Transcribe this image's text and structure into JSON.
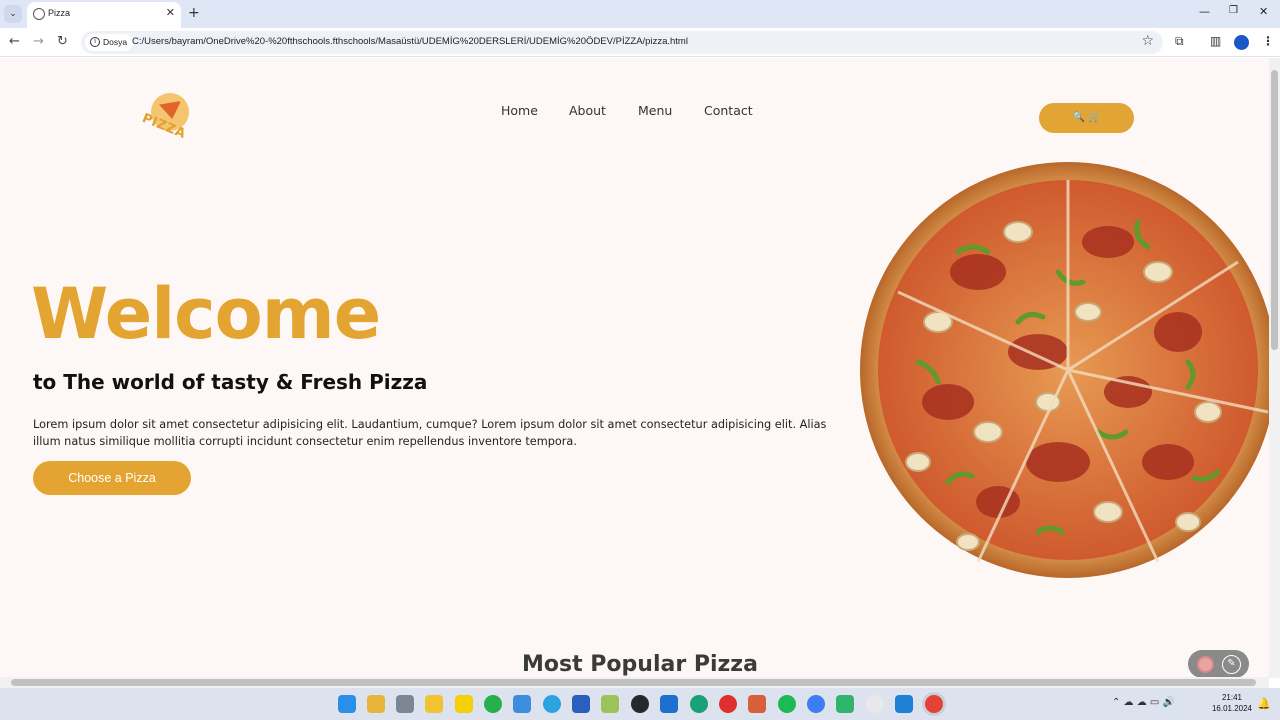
{
  "browser": {
    "tab_title": "Pizza",
    "tab_close": "✕",
    "new_tab": "+",
    "site_chip": "Dosya",
    "url": "C:/Users/bayram/OneDrive%20-%20fthschools.fthschools/Masaüstü/UDEMİG%20DERSLERİ/UDEMİG%20ÖDEV/PİZZA/pizza.html",
    "window_controls": {
      "minimize": "—",
      "maximize": "❐",
      "close": "✕"
    }
  },
  "site": {
    "logo_text": "PIZZA",
    "nav": [
      "Home",
      "About",
      "Menu",
      "Contact"
    ],
    "cart_icons": "🔍 🛒"
  },
  "hero": {
    "title": "Welcome",
    "subtitle": "to The world of tasty & Fresh Pizza",
    "text": "Lorem ipsum dolor sit amet consectetur adipisicing elit. Laudantium, cumque? Lorem ipsum dolor sit amet consectetur adipisicing elit. Alias illum natus similique mollitia corrupti incidunt consectetur enim repellendus inventore tempora.",
    "button": "Choose a Pizza"
  },
  "section": {
    "title": "Most Popular Pizza"
  },
  "colors": {
    "accent": "#e3a431",
    "page_bg": "#fdf8f6",
    "crust": "#d98a3c",
    "sauce": "#c8452a"
  },
  "taskbar": {
    "time": "21:41",
    "date": "16.01.2024",
    "apps": [
      "windows-start",
      "weather",
      "task-view",
      "file-explorer",
      "sticky-notes",
      "whatsapp",
      "files",
      "telegram",
      "word",
      "notepad",
      "github",
      "edge",
      "opera",
      "git",
      "spotify",
      "messenger",
      "app-green",
      "slack",
      "vscode",
      "chrome"
    ]
  }
}
